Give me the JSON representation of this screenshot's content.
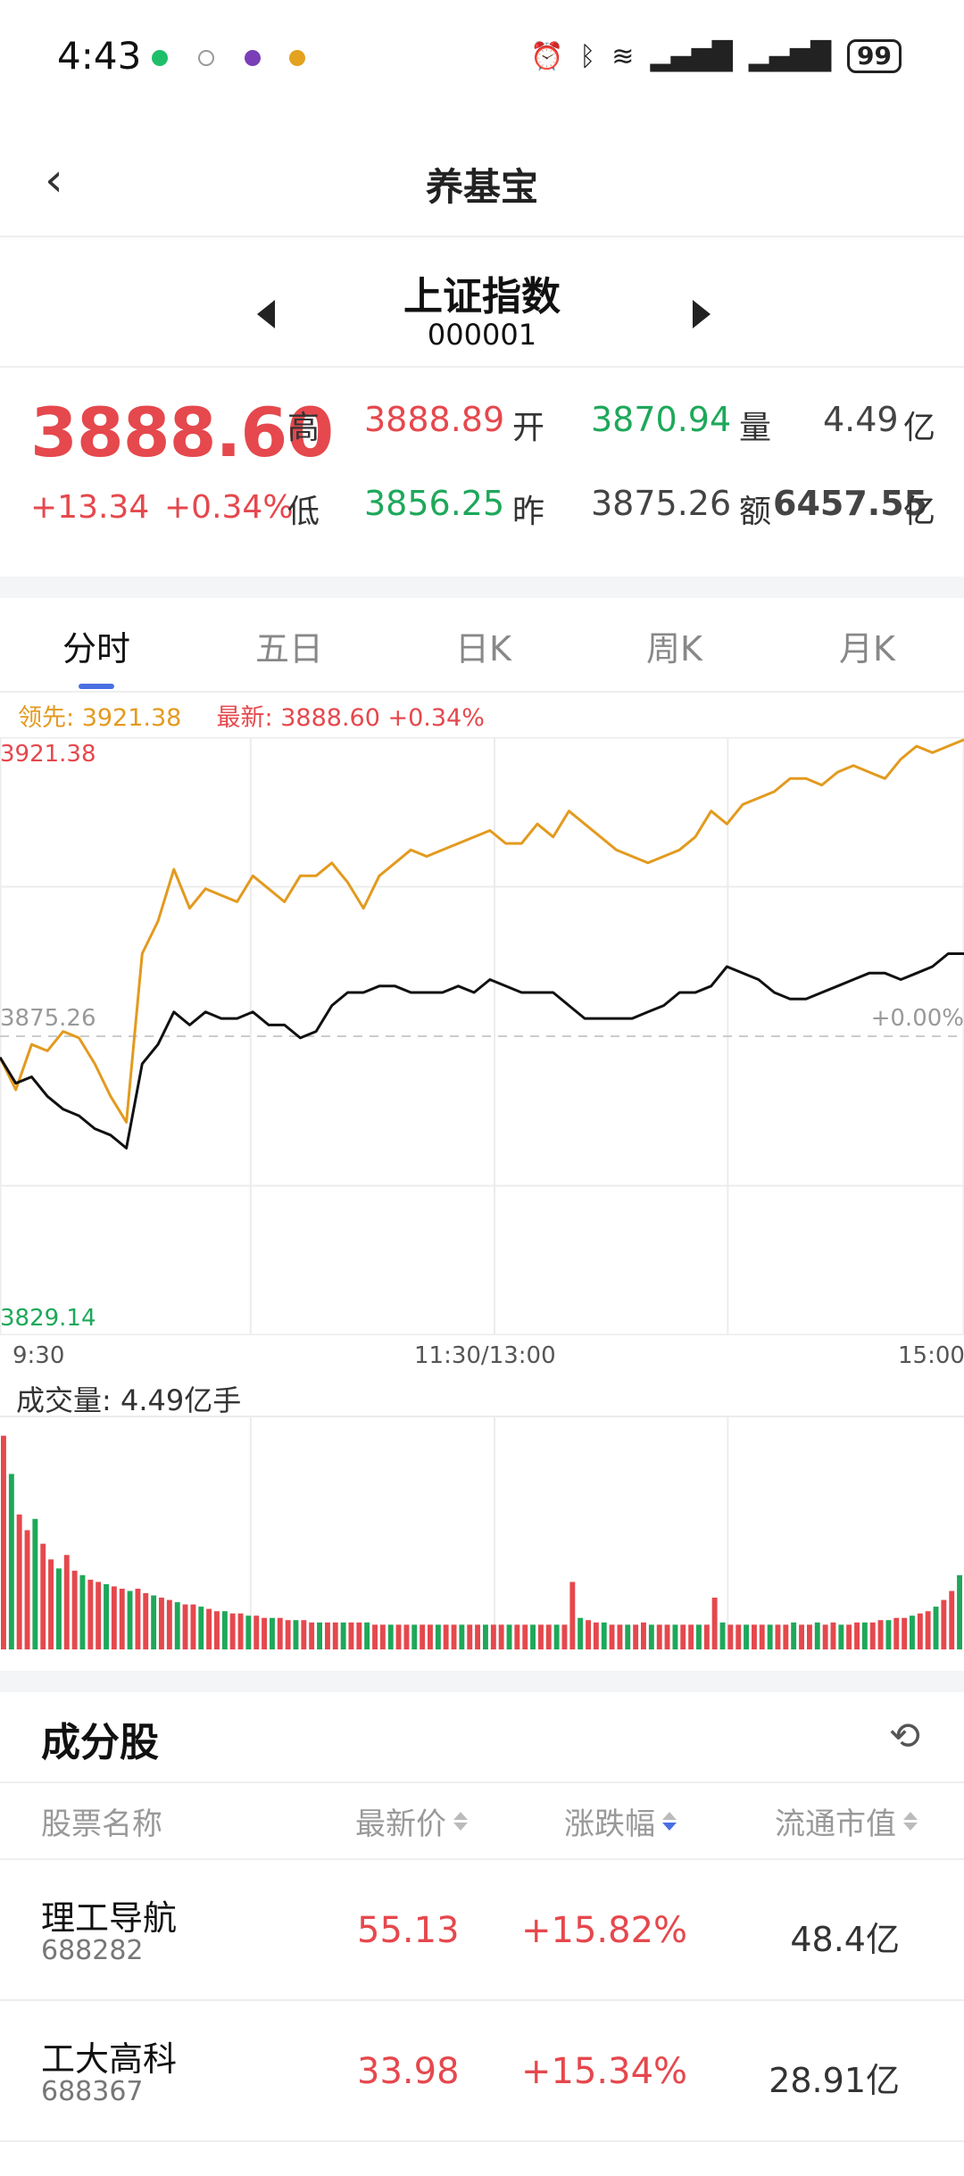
{
  "status_bar": {
    "time": "4:43",
    "battery": "99"
  },
  "nav": {
    "title": "养基宝",
    "back_icon": "chevron-left-icon"
  },
  "index": {
    "name": "上证指数",
    "code": "000001"
  },
  "quote": {
    "price": "3888.60",
    "change": "+13.34",
    "change_pct": "+0.34%",
    "high_label": "高",
    "high": "3888.89",
    "low_label": "低",
    "low": "3856.25",
    "open_label": "开",
    "open": "3870.94",
    "prev_label": "昨",
    "prev": "3875.26",
    "volume_label": "量",
    "volume": "4.49",
    "volume_unit": "亿",
    "amount_label": "额",
    "amount": "6457.55",
    "amount_unit": "亿"
  },
  "tabs": [
    "分时",
    "五日",
    "日K",
    "周K",
    "月K"
  ],
  "legend": {
    "lead_label": "领先:",
    "lead_value": "3921.38",
    "latest_label": "最新:",
    "latest_value": "3888.60",
    "latest_pct": "+0.34%"
  },
  "chart_labels": {
    "y_top": "3921.38",
    "y_mid": "3875.26",
    "y_mid_pct": "+0.00%",
    "y_bottom": "3829.14",
    "x_start": "9:30",
    "x_mid": "11:30/13:00",
    "x_end": "15:00"
  },
  "volume": {
    "label": "成交量:",
    "value": "4.49亿手"
  },
  "chart_data": {
    "type": "line",
    "title": "",
    "xlabel": "",
    "ylabel": "",
    "x_ticks": [
      "9:30",
      "11:30/13:00",
      "15:00"
    ],
    "ylim": [
      3829.14,
      3921.38
    ],
    "baseline": 3875.26,
    "grid": true,
    "series": [
      {
        "color": "#e39a1f",
        "values": [
          3872,
          3867,
          3874,
          3873,
          3876,
          3875,
          3871,
          3866,
          3862,
          3888,
          3893,
          3901,
          3895,
          3898,
          3897,
          3896,
          3900,
          3898,
          3896,
          3900,
          3900,
          3902,
          3899,
          3895,
          3900,
          3902,
          3904,
          3903,
          3904,
          3905,
          3906,
          3907,
          3905,
          3905,
          3908,
          3906,
          3910,
          3908,
          3906,
          3904,
          3903,
          3902,
          3903,
          3904,
          3906,
          3910,
          3908,
          3911,
          3912,
          3913,
          3915,
          3915,
          3914,
          3916,
          3917,
          3916,
          3915,
          3918,
          3920,
          3919,
          3920,
          3921
        ]
      },
      {
        "color": "#111111",
        "values": [
          3872,
          3868,
          3869,
          3866,
          3864,
          3863,
          3861,
          3860,
          3858,
          3871,
          3874,
          3879,
          3877,
          3879,
          3878,
          3878,
          3879,
          3877,
          3877,
          3875,
          3876,
          3880,
          3882,
          3882,
          3883,
          3883,
          3882,
          3882,
          3882,
          3883,
          3882,
          3884,
          3883,
          3882,
          3882,
          3882,
          3880,
          3878,
          3878,
          3878,
          3878,
          3879,
          3880,
          3882,
          3882,
          3883,
          3886,
          3885,
          3884,
          3882,
          3881,
          3881,
          3882,
          3883,
          3884,
          3885,
          3885,
          3884,
          3885,
          3886,
          3888,
          3888
        ]
      }
    ]
  },
  "volume_bars": [
    95,
    78,
    60,
    53,
    58,
    47,
    40,
    36,
    42,
    35,
    33,
    31,
    30,
    29,
    28,
    27,
    26,
    27,
    25,
    24,
    23,
    22,
    21,
    20,
    20,
    19,
    18,
    17,
    17,
    16,
    16,
    15,
    15,
    14,
    14,
    14,
    13,
    13,
    13,
    12,
    12,
    12,
    12,
    12,
    12,
    12,
    12,
    11,
    11,
    11,
    11,
    11,
    11,
    11,
    11,
    11,
    11,
    11,
    11,
    11,
    11,
    11,
    11,
    11,
    11,
    11,
    11,
    11,
    11,
    11,
    11,
    11,
    30,
    14,
    13,
    12,
    12,
    11,
    11,
    11,
    11,
    12,
    11,
    11,
    11,
    11,
    11,
    11,
    11,
    11,
    23,
    12,
    11,
    11,
    11,
    11,
    11,
    11,
    11,
    11,
    12,
    11,
    11,
    12,
    11,
    12,
    11,
    11,
    12,
    12,
    12,
    13,
    13,
    14,
    14,
    15,
    16,
    17,
    19,
    22,
    26,
    33
  ],
  "components": {
    "title": "成分股",
    "refresh_icon": "refresh-icon",
    "headers": {
      "name": "股票名称",
      "price": "最新价",
      "pct": "涨跌幅",
      "cap": "流通市值"
    },
    "rows": [
      {
        "name": "理工导航",
        "code": "688282",
        "price": "55.13",
        "pct": "+15.82%",
        "cap": "48.4亿"
      },
      {
        "name": "工大高科",
        "code": "688367",
        "price": "33.98",
        "pct": "+15.34%",
        "cap": "28.91亿"
      }
    ]
  },
  "colors": {
    "up": "#e5484d",
    "down": "#1ea85a",
    "accent": "#4a6fe3",
    "lead_line": "#e39a1f"
  }
}
